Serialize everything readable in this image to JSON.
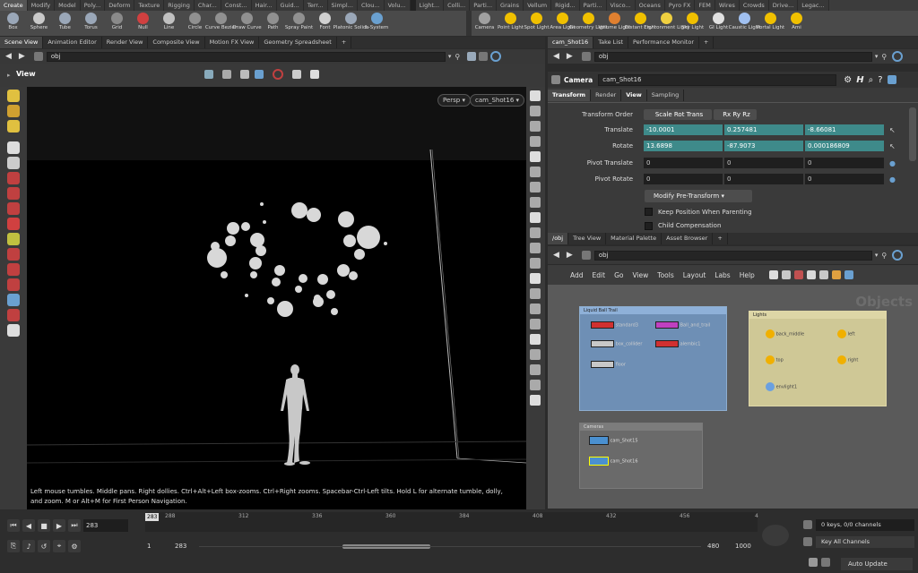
{
  "shelf_tabs_left": [
    "Create",
    "Modify",
    "Model",
    "Poly...",
    "Deform",
    "Texture",
    "Rigging",
    "Char...",
    "Const...",
    "Hair...",
    "Guid...",
    "Terr...",
    "Simpl...",
    "Clou...",
    "Volu..."
  ],
  "shelf_tabs_right": [
    "Light...",
    "Colli...",
    "Parti...",
    "Grains",
    "Vellum",
    "Rigid...",
    "Parti...",
    "Visco...",
    "Oceans",
    "Pyro FX",
    "FEM",
    "Wires",
    "Crowds",
    "Drive...",
    "Legac..."
  ],
  "tools_left": [
    {
      "label": "Box",
      "color": "#9aa7b8"
    },
    {
      "label": "Sphere",
      "color": "#c9c9c9"
    },
    {
      "label": "Tube",
      "color": "#9aa7b8"
    },
    {
      "label": "Torus",
      "color": "#9aa7b8"
    },
    {
      "label": "Grid",
      "color": "#8a8a8a"
    },
    {
      "label": "Null",
      "color": "#d04040"
    },
    {
      "label": "Line",
      "color": "#c0c0c0"
    },
    {
      "label": "Circle",
      "color": "#909090"
    },
    {
      "label": "Curve Bezier",
      "color": "#909090"
    },
    {
      "label": "Draw Curve",
      "color": "#909090"
    },
    {
      "label": "Path",
      "color": "#909090"
    },
    {
      "label": "Spray Paint",
      "color": "#909090"
    },
    {
      "label": "Font",
      "color": "#d0d0d0"
    },
    {
      "label": "Platonic Solids",
      "color": "#9aa7b8"
    },
    {
      "label": "L-System",
      "color": "#6aa0d0"
    }
  ],
  "tools_right": [
    {
      "label": "Camera",
      "color": "#a0a0a0"
    },
    {
      "label": "Point Light",
      "color": "#f0c000"
    },
    {
      "label": "Spot Light",
      "color": "#f0c000"
    },
    {
      "label": "Area Light",
      "color": "#f0c000"
    },
    {
      "label": "Geometry Light",
      "color": "#f0c000"
    },
    {
      "label": "Volume Light",
      "color": "#e08030"
    },
    {
      "label": "Distant Light",
      "color": "#f0c000"
    },
    {
      "label": "Environment Light",
      "color": "#f0d040"
    },
    {
      "label": "Sky Light",
      "color": "#f0c000"
    },
    {
      "label": "GI Light",
      "color": "#e0e0e0"
    },
    {
      "label": "Caustic Light",
      "color": "#a0c0f0"
    },
    {
      "label": "Portal Light",
      "color": "#f0c000"
    },
    {
      "label": "Ami",
      "color": "#f0c000"
    }
  ],
  "left_tabs": [
    "Scene View",
    "Animation Editor",
    "Render View",
    "Composite View",
    "Motion FX View",
    "Geometry Spreadsheet"
  ],
  "right_tabs": [
    "cam_Shot16",
    "Take List",
    "Performance Monitor"
  ],
  "left_path": "obj",
  "right_path": "obj",
  "viewport": {
    "title": "View",
    "persp": "Persp",
    "camera": "cam_Shot16",
    "help": "Left mouse tumbles. Middle pans. Right dollies. Ctrl+Alt+Left box-zooms. Ctrl+Right zooms. Spacebar-Ctrl-Left tilts. Hold L for alternate tumble, dolly, and zoom.    M or Alt+M for First Person Navigation."
  },
  "params": {
    "type_label": "Camera",
    "node_name": "cam_Shot16",
    "tabs": [
      "Transform",
      "Render",
      "View",
      "Sampling"
    ],
    "transform_order_label": "Transform Order",
    "transform_order": "Scale Rot Trans",
    "rot_order": "Rx Ry Rz",
    "translate_label": "Translate",
    "translate": [
      "-10.0001",
      "0.257481",
      "-8.66081"
    ],
    "rotate_label": "Rotate",
    "rotate": [
      "13.6898",
      "-87.9073",
      "0.000186809"
    ],
    "pivot_translate_label": "Pivot Translate",
    "pivot_translate": [
      "0",
      "0",
      "0"
    ],
    "pivot_rotate_label": "Pivot Rotate",
    "pivot_rotate": [
      "0",
      "0",
      "0"
    ],
    "modify_pre": "Modify Pre-Transform",
    "keep_position": "Keep Position When Parenting",
    "child_comp": "Child Compensation"
  },
  "network_tabs": [
    "/obj",
    "Tree View",
    "Material Palette",
    "Asset Browser"
  ],
  "network_menu": [
    "Add",
    "Edit",
    "Go",
    "View",
    "Tools",
    "Layout",
    "Labs",
    "Help"
  ],
  "network": {
    "context_label": "Objects",
    "box_liquid": {
      "title": "Liquid Ball Trail",
      "nodes": [
        "standard3",
        "Ball_and_trail",
        "box_collider",
        "alembic1",
        "floor"
      ]
    },
    "box_lights": {
      "title": "Lights",
      "nodes": [
        "back_middle",
        "left",
        "top",
        "right",
        "envlight1"
      ]
    },
    "box_cameras": {
      "title": "Cameras",
      "nodes": [
        "cam_Shot15",
        "cam_Shot16"
      ]
    }
  },
  "timeline": {
    "current_frame": "283",
    "ticks": [
      "288",
      "312",
      "336",
      "360",
      "384",
      "408",
      "432",
      "456",
      "4"
    ],
    "range_start": "1",
    "range_start2": "283",
    "range_end": "480",
    "range_end2": "1000",
    "keys_info": "0 keys, 0/0 channels",
    "key_channels": "Key All Channels",
    "update_mode": "Auto Update"
  },
  "colors": {
    "teal": "#3e8a8a",
    "net_blue": "#6e8fb5",
    "net_yellow": "#cfc896",
    "net_gray": "#5e5e5e"
  }
}
